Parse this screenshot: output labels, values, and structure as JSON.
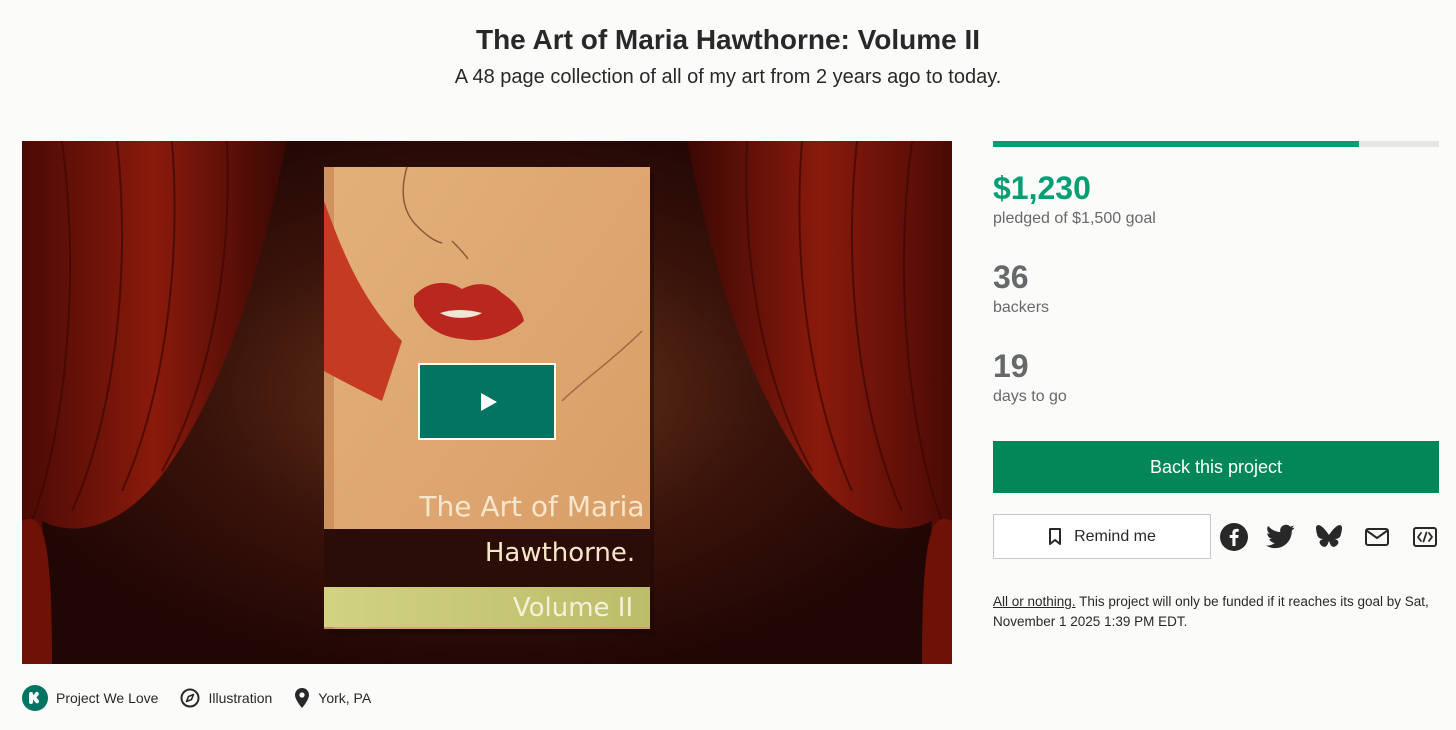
{
  "project": {
    "title": "The Art of Maria Hawthorne: Volume II",
    "blurb": "A 48 page collection of all of my art from 2 years ago to today."
  },
  "video": {
    "cover_line1": "The Art of Maria",
    "cover_line2": "Hawthorne.",
    "cover_line3": "Volume II",
    "play_icon": "play-icon"
  },
  "funding": {
    "progress": 0.82,
    "pledged": "$1,230",
    "pledged_label": "pledged of $1,500 goal",
    "backers": "36",
    "backers_label": "backers",
    "days": "19",
    "days_label": "days to go"
  },
  "actions": {
    "back_label": "Back this project",
    "remind_label": "Remind me",
    "share_icons": [
      "facebook-icon",
      "twitter-icon",
      "bluesky-icon",
      "email-icon",
      "embed-icon"
    ]
  },
  "fine_print": {
    "link": "All or nothing.",
    "text": " This project will only be funded if it reaches its goal by Sat, November 1 2025 1:39 PM EDT."
  },
  "meta": {
    "badge": "Project We Love",
    "category": "Illustration",
    "location": "York, PA"
  },
  "colors": {
    "accent_green": "#029e74",
    "button_green": "#028858",
    "play_green": "#037362"
  }
}
